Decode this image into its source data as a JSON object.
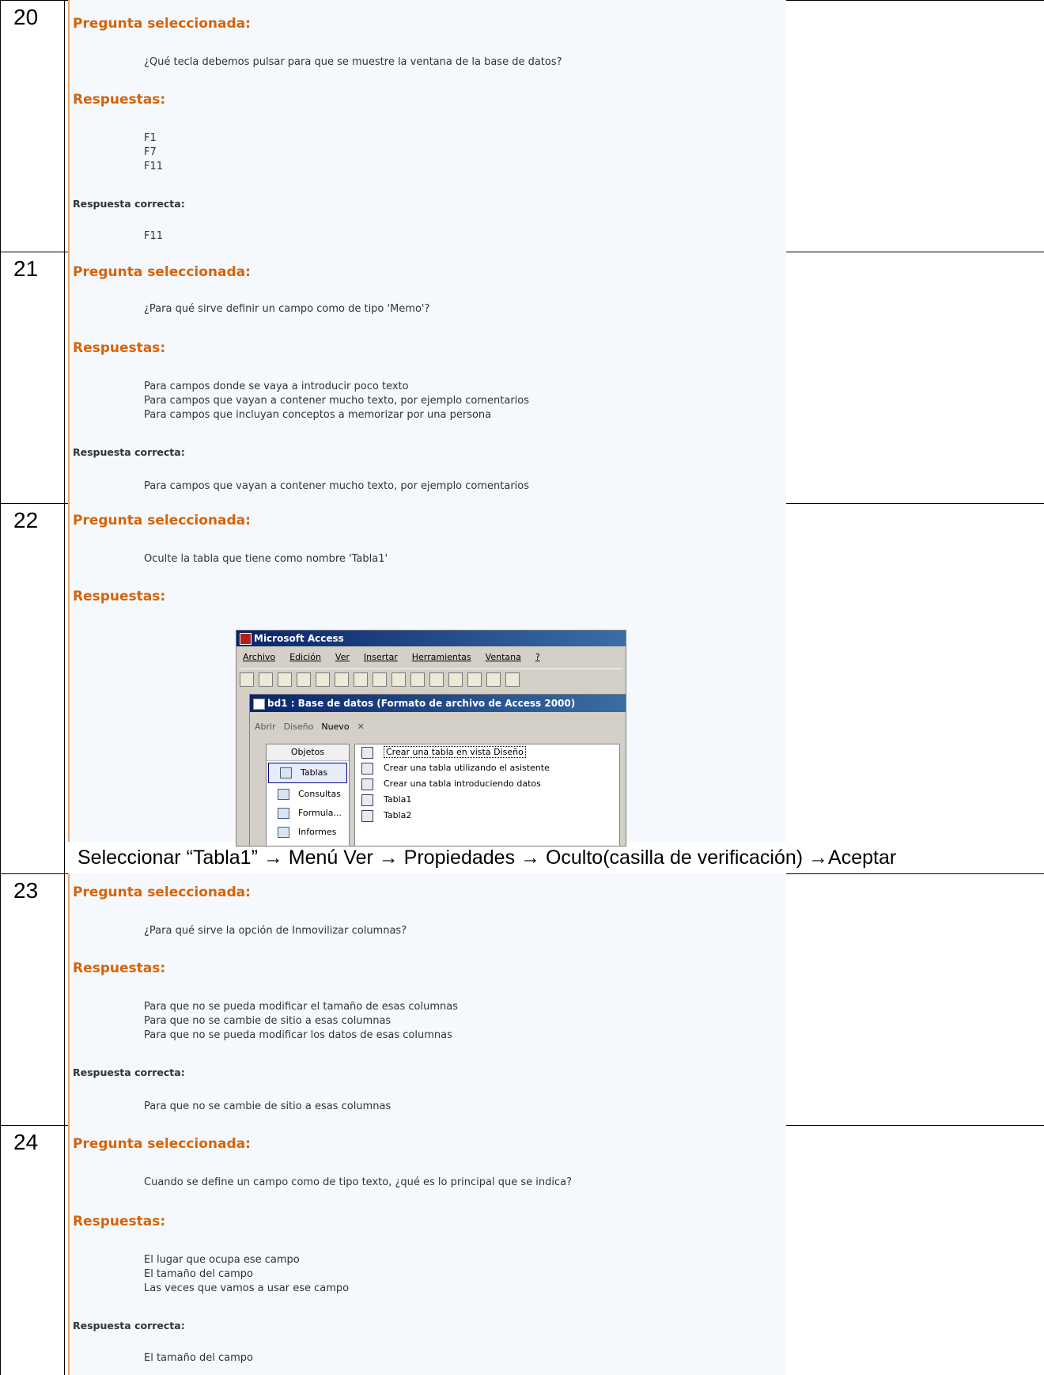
{
  "labels": {
    "pregunta": "Pregunta seleccionada:",
    "respuestas": "Respuestas:",
    "correcta": "Respuesta correcta:"
  },
  "questions": [
    {
      "number": "20",
      "question": "¿Qué tecla debemos pulsar para que se muestre la ventana de la base de datos?",
      "answers": [
        "F1",
        "F7",
        "F11"
      ],
      "correct": "F11"
    },
    {
      "number": "21",
      "question": "¿Para qué sirve definir un campo como de tipo 'Memo'?",
      "answers": [
        "Para campos donde se vaya a introducir poco texto",
        "Para campos que vayan a contener mucho texto, por ejemplo comentarios",
        "Para campos que incluyan conceptos a memorizar por una persona"
      ],
      "correct": "Para campos que vayan a contener mucho texto, por ejemplo comentarios"
    },
    {
      "number": "22",
      "question": "Oculte la tabla que tiene como nombre 'Tabla1'",
      "solution": "Seleccionar “Tabla1” → Menú Ver → Propiedades → Oculto(casilla de verificación) →Aceptar"
    },
    {
      "number": "23",
      "question": "¿Para qué sirve la opción de Inmovilizar columnas?",
      "answers": [
        "Para que no se pueda modificar el tamaño de esas columnas",
        "Para que no se cambie de sitio a esas columnas",
        "Para que no se pueda modificar los datos de esas columnas"
      ],
      "correct": "Para que no se cambie de sitio a esas columnas"
    },
    {
      "number": "24",
      "question": "Cuando se define un campo como de tipo texto, ¿qué es lo principal que se indica?",
      "answers": [
        "El lugar que ocupa ese campo",
        "El tamaño del campo",
        "Las veces que vamos a usar ese campo"
      ],
      "correct": "El tamaño del campo"
    }
  ],
  "access": {
    "app_title": "Microsoft Access",
    "menu": [
      "Archivo",
      "Edición",
      "Ver",
      "Insertar",
      "Herramientas",
      "Ventana",
      "?"
    ],
    "db_title": "bd1 : Base de datos (Formato de archivo de Access 2000)",
    "db_toolbar": [
      "Abrir",
      "Diseño",
      "Nuevo"
    ],
    "objects_header": "Objetos",
    "objects": [
      "Tablas",
      "Consultas",
      "Formula...",
      "Informes"
    ],
    "list": [
      "Crear una tabla en vista Diseño",
      "Crear una tabla utilizando el asistente",
      "Crear una tabla introduciendo datos",
      "Tabla1",
      "Tabla2"
    ]
  }
}
